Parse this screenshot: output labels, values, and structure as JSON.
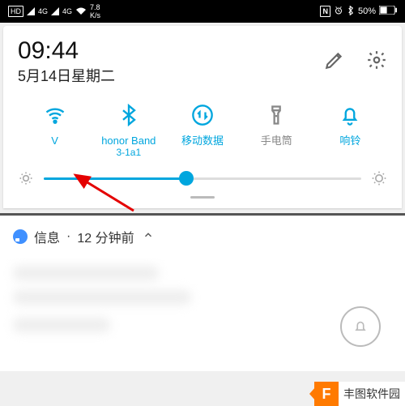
{
  "status": {
    "hd": "HD",
    "net4g_a": "4G",
    "net4g_b": "4G",
    "rate_top": "7.8",
    "rate_bot": "K/s",
    "nfc": "N",
    "battery_pct": "50%"
  },
  "panel": {
    "time": "09:44",
    "date": "5月14日星期二"
  },
  "toggles": {
    "wifi": {
      "label": "V"
    },
    "bluetooth": {
      "label": "honor Band",
      "sub": "3-1a1"
    },
    "mobiledata": {
      "label": "移动数据"
    },
    "flashlight": {
      "label": "手电筒"
    },
    "ringer": {
      "label": "响铃"
    }
  },
  "brightness": {
    "percent": 45
  },
  "notification": {
    "app": "信息",
    "sep": " · ",
    "time": "12 分钟前"
  },
  "watermark": "丰图软件园"
}
